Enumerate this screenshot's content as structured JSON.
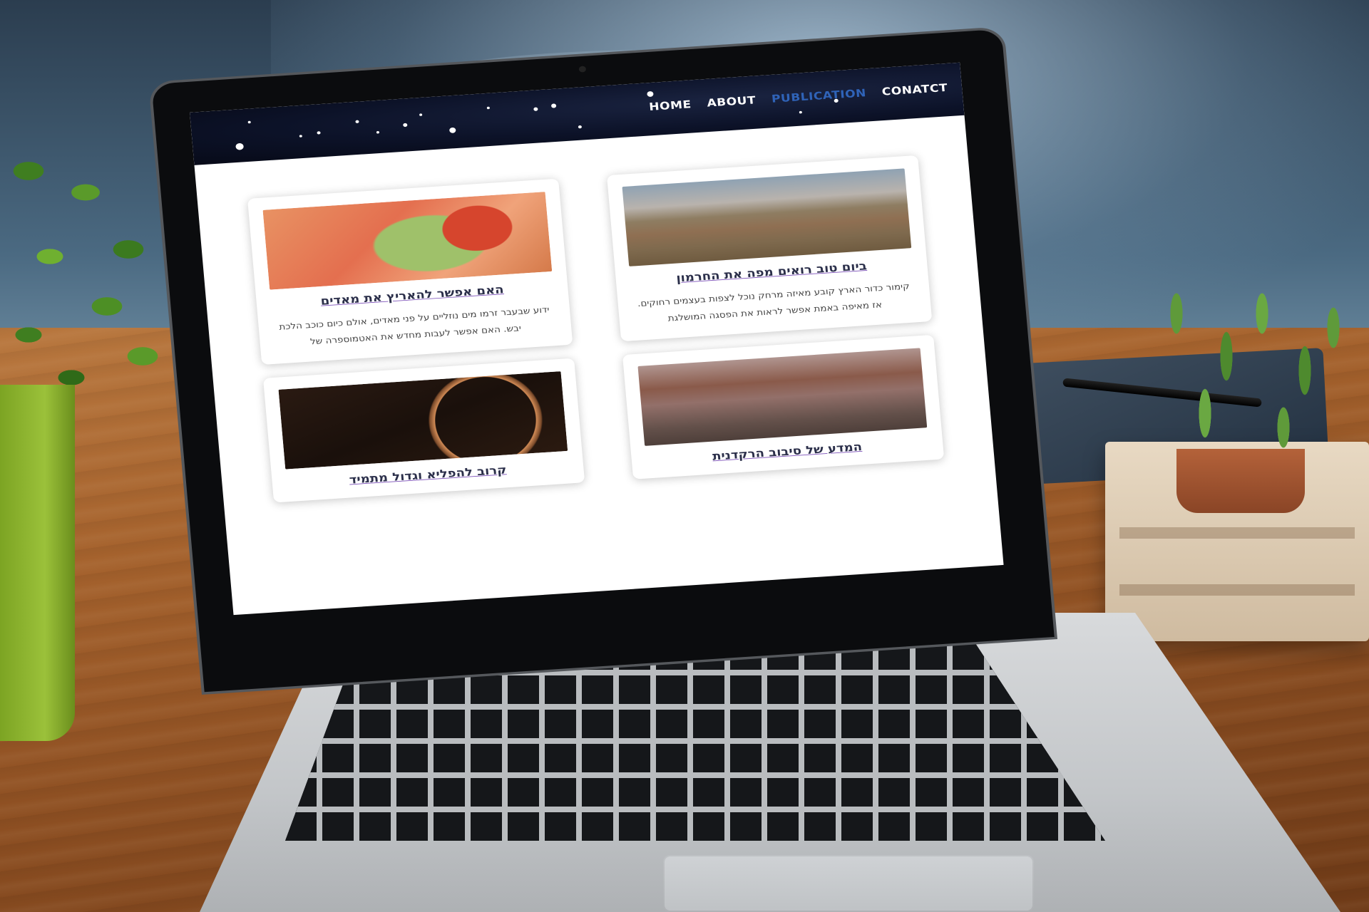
{
  "nav": {
    "home": "HOME",
    "about": "ABOUT",
    "publication": "PUBLICATION",
    "contact": "CONATCT",
    "active": "PUBLICATION"
  },
  "articles": [
    {
      "title": "ביום טוב רואים מפה את החרמון",
      "excerpt": "קימור כדור הארץ קובע מאיזה מרחק נוכל לצפות בעצמים רחוקים. אז מאיפה באמת אפשר לראות את הפסגה המושלגת",
      "image": "mountain-landscape-image"
    },
    {
      "title": "האם אפשר להאריץ את מאדים",
      "excerpt": "ידוע שבעבר זרמו מים נוזליים על פני מאדים, אולם כיום כוכב הלכת יבש. האם אפשר לעבות מחדש את האטמוספרה של",
      "image": "mars-terraform-image"
    },
    {
      "title": "המדע של סיבוב הרקדנית",
      "excerpt": "",
      "image": "ballet-dancer-image"
    },
    {
      "title": "קרוב להפליא וגדול מתמיד",
      "excerpt": "",
      "image": "moon-crescent-image"
    }
  ],
  "colors": {
    "nav_active": "#2f63b8",
    "header_bg": "#0c1228",
    "title_underline": "#7b4fb8"
  }
}
